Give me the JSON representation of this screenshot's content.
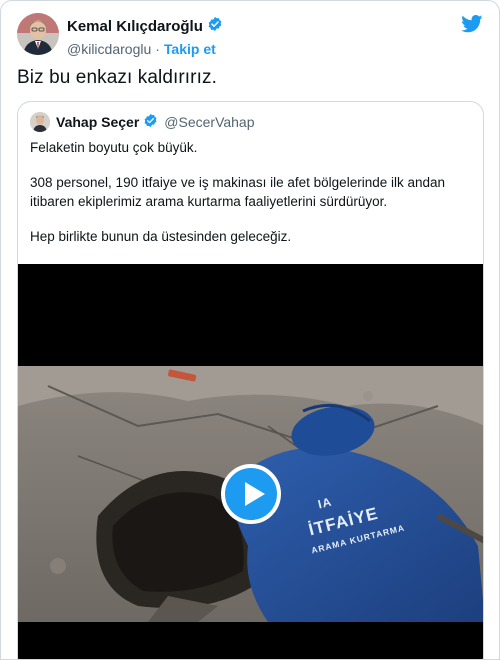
{
  "tweet": {
    "author_name": "Kemal Kılıçdaroğlu",
    "author_handle": "@kilicdaroglu",
    "separator": "·",
    "follow_label": "Takip et",
    "text": "Biz bu enkazı kaldırırız.",
    "brand_color": "#1d9bf0",
    "icons": [
      "verified-badge-icon",
      "twitter-bird-icon"
    ]
  },
  "quoted": {
    "author_name": "Vahap Seçer",
    "author_handle": "@SecerVahap",
    "paragraphs": [
      "Felaketin boyutu çok büyük.",
      "308 personel, 190 itfaiye ve iş makinası ile afet bölgelerinde ilk andan itibaren ekiplerimiz arama kurtarma faaliyetlerini sürdürüyor.",
      "Hep birlikte bunun da üstesinden geleceğiz."
    ],
    "video": {
      "vest_text_top": "İTFAİYE",
      "vest_text_bottom": "ARAMA KURTARMA",
      "vest_text_fragment": "IA",
      "icons": [
        "play-icon"
      ]
    }
  }
}
